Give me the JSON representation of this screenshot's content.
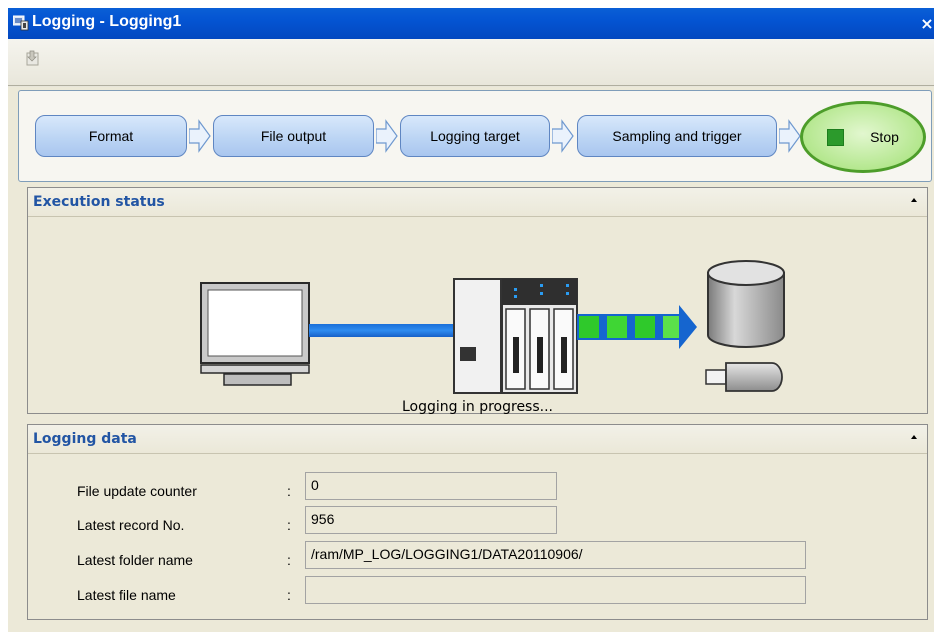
{
  "window": {
    "title": "Logging - Logging1",
    "close_glyph": "×"
  },
  "toolbar": {
    "icon": "export-icon"
  },
  "flow": {
    "steps": [
      "Format",
      "File output",
      "Logging target",
      "Sampling and trigger"
    ],
    "stop_label": "Stop"
  },
  "execution": {
    "title": "Execution status",
    "status_text": "Logging in progress..."
  },
  "logging_data": {
    "title": "Logging data",
    "fields": [
      {
        "label": "File update counter",
        "value": "0"
      },
      {
        "label": "Latest record No.",
        "value": "956"
      },
      {
        "label": "Latest folder name",
        "value": "/ram/MP_LOG/LOGGING1/DATA20110906/"
      },
      {
        "label": "Latest file name",
        "value": ""
      }
    ],
    "colon": ":"
  },
  "colors": {
    "titlebar": "#0454d2",
    "step_fill": "#bcd5f4",
    "stop_fill": "#b4e78e",
    "panel_title": "#2255a4",
    "transfer_green": "#39d12e"
  }
}
